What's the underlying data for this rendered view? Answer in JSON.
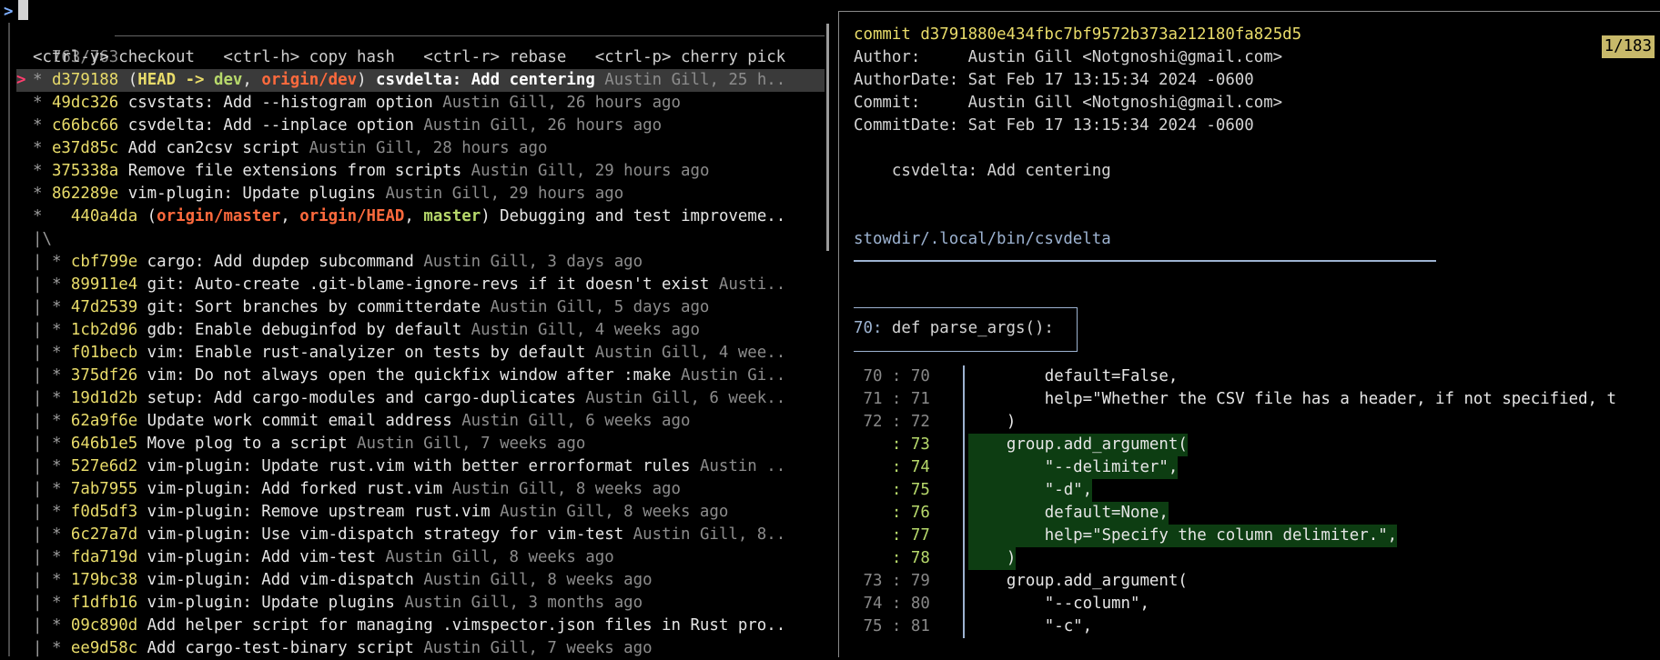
{
  "prompt": {
    "symbol": ">"
  },
  "left": {
    "counter": "763/763",
    "hints": "<ctrl-y> checkout   <ctrl-h> copy hash   <ctrl-r> rebase   <ctrl-p> cherry pick",
    "rows": [
      {
        "mark": ">",
        "graph": "* ",
        "hash": "d379188",
        "refs": [
          {
            "t": "(",
            "c": "rb"
          },
          {
            "t": "HEAD -> ",
            "c": "rh"
          },
          {
            "t": "dev",
            "c": "rg"
          },
          {
            "t": ", ",
            "c": "rb"
          },
          {
            "t": "origin/dev",
            "c": "rr"
          },
          {
            "t": ") ",
            "c": "rb"
          }
        ],
        "msg": "csvdelta: Add centering",
        "meta": " Austin Gill, 25 h..",
        "sel": true
      },
      {
        "mark": "",
        "graph": "* ",
        "hash": "49dc326",
        "refs": [],
        "msg": "csvstats: Add --histogram option",
        "meta": " Austin Gill, 26 hours ago"
      },
      {
        "mark": "",
        "graph": "* ",
        "hash": "c66bc66",
        "refs": [],
        "msg": "csvdelta: Add --inplace option",
        "meta": " Austin Gill, 26 hours ago"
      },
      {
        "mark": "",
        "graph": "* ",
        "hash": "e37d85c",
        "refs": [],
        "msg": "Add can2csv script",
        "meta": " Austin Gill, 28 hours ago"
      },
      {
        "mark": "",
        "graph": "* ",
        "hash": "375338a",
        "refs": [],
        "msg": "Remove file extensions from scripts",
        "meta": " Austin Gill, 29 hours ago"
      },
      {
        "mark": "",
        "graph": "* ",
        "hash": "862289e",
        "refs": [],
        "msg": "vim-plugin: Update plugins",
        "meta": " Austin Gill, 29 hours ago"
      },
      {
        "mark": "",
        "graph": "*   ",
        "hash": "440a4da",
        "refs": [
          {
            "t": "(",
            "c": "rb"
          },
          {
            "t": "origin/master",
            "c": "rr"
          },
          {
            "t": ", ",
            "c": "rb"
          },
          {
            "t": "origin/HEAD",
            "c": "rr"
          },
          {
            "t": ", ",
            "c": "rb"
          },
          {
            "t": "master",
            "c": "rg"
          },
          {
            "t": ") ",
            "c": "rb"
          }
        ],
        "msg": "Debugging and test improveme..",
        "meta": ""
      },
      {
        "mark": "",
        "graph": "|\\",
        "hash": "",
        "refs": [],
        "msg": "",
        "meta": ""
      },
      {
        "mark": "",
        "graph": "| * ",
        "hash": "cbf799e",
        "refs": [],
        "msg": "cargo: Add dupdep subcommand",
        "meta": " Austin Gill, 3 days ago"
      },
      {
        "mark": "",
        "graph": "| * ",
        "hash": "89911e4",
        "refs": [],
        "msg": "git: Auto-create .git-blame-ignore-revs if it doesn't exist",
        "meta": " Austi.."
      },
      {
        "mark": "",
        "graph": "| * ",
        "hash": "47d2539",
        "refs": [],
        "msg": "git: Sort branches by committerdate",
        "meta": " Austin Gill, 5 days ago"
      },
      {
        "mark": "",
        "graph": "| * ",
        "hash": "1cb2d96",
        "refs": [],
        "msg": "gdb: Enable debuginfod by default",
        "meta": " Austin Gill, 4 weeks ago"
      },
      {
        "mark": "",
        "graph": "| * ",
        "hash": "f01becb",
        "refs": [],
        "msg": "vim: Enable rust-analyizer on tests by default",
        "meta": " Austin Gill, 4 wee.."
      },
      {
        "mark": "",
        "graph": "| * ",
        "hash": "375df26",
        "refs": [],
        "msg": "vim: Do not always open the quickfix window after :make",
        "meta": " Austin Gi.."
      },
      {
        "mark": "",
        "graph": "| * ",
        "hash": "19d1d2b",
        "refs": [],
        "msg": "setup: Add cargo-modules and cargo-duplicates",
        "meta": " Austin Gill, 6 week.."
      },
      {
        "mark": "",
        "graph": "| * ",
        "hash": "62a9f6e",
        "refs": [],
        "msg": "Update work commit email address",
        "meta": " Austin Gill, 6 weeks ago"
      },
      {
        "mark": "",
        "graph": "| * ",
        "hash": "646b1e5",
        "refs": [],
        "msg": "Move plog to a script",
        "meta": " Austin Gill, 7 weeks ago"
      },
      {
        "mark": "",
        "graph": "| * ",
        "hash": "527e6d2",
        "refs": [],
        "msg": "vim-plugin: Update rust.vim with better errorformat rules",
        "meta": " Austin .."
      },
      {
        "mark": "",
        "graph": "| * ",
        "hash": "7ab7955",
        "refs": [],
        "msg": "vim-plugin: Add forked rust.vim",
        "meta": " Austin Gill, 8 weeks ago"
      },
      {
        "mark": "",
        "graph": "| * ",
        "hash": "f0d5df3",
        "refs": [],
        "msg": "vim-plugin: Remove upstream rust.vim",
        "meta": " Austin Gill, 8 weeks ago"
      },
      {
        "mark": "",
        "graph": "| * ",
        "hash": "6c27a7d",
        "refs": [],
        "msg": "vim-plugin: Use vim-dispatch strategy for vim-test",
        "meta": " Austin Gill, 8.."
      },
      {
        "mark": "",
        "graph": "| * ",
        "hash": "fda719d",
        "refs": [],
        "msg": "vim-plugin: Add vim-test",
        "meta": " Austin Gill, 8 weeks ago"
      },
      {
        "mark": "",
        "graph": "| * ",
        "hash": "179bc38",
        "refs": [],
        "msg": "vim-plugin: Add vim-dispatch",
        "meta": " Austin Gill, 8 weeks ago"
      },
      {
        "mark": "",
        "graph": "| * ",
        "hash": "f1dfb16",
        "refs": [],
        "msg": "vim-plugin: Update plugins",
        "meta": " Austin Gill, 3 months ago"
      },
      {
        "mark": "",
        "graph": "| * ",
        "hash": "09c890d",
        "refs": [],
        "msg": "Add helper script for managing .vimspector.json files in Rust pro..",
        "meta": ""
      },
      {
        "mark": "",
        "graph": "| * ",
        "hash": "ee9d58c",
        "refs": [],
        "msg": "Add cargo-test-binary script",
        "meta": " Austin Gill, 7 weeks ago"
      }
    ]
  },
  "preview": {
    "page_indicator": "1/183",
    "commit_label": "commit",
    "commit_hash": "d3791880e434fbc7bf9572b373a212180fa825d5",
    "author": "Author:     Austin Gill <Notgnoshi@gmail.com>",
    "author_date": "AuthorDate: Sat Feb 17 13:15:34 2024 -0600",
    "committer": "Commit:     Austin Gill <Notgnoshi@gmail.com>",
    "commit_date": "CommitDate: Sat Feb 17 13:15:34 2024 -0600",
    "message": "    csvdelta: Add centering",
    "file_path": "stowdir/.local/bin/csvdelta",
    "hunk_line": "70:",
    "hunk_text": " def parse_args():",
    "code": [
      {
        "old": "70",
        "new": "70",
        "text": "        default=False,",
        "added": false
      },
      {
        "old": "71",
        "new": "71",
        "text": "        help=\"Whether the CSV file has a header, if not specified, t",
        "added": false
      },
      {
        "old": "72",
        "new": "72",
        "text": "    )",
        "added": false
      },
      {
        "old": "",
        "new": "73",
        "text": "    group.add_argument(",
        "added": true
      },
      {
        "old": "",
        "new": "74",
        "text": "        \"--delimiter\",",
        "added": true
      },
      {
        "old": "",
        "new": "75",
        "text": "        \"-d\",",
        "added": true
      },
      {
        "old": "",
        "new": "76",
        "text": "        default=None,",
        "added": true
      },
      {
        "old": "",
        "new": "77",
        "text": "        help=\"Specify the column delimiter.\",",
        "added": true
      },
      {
        "old": "",
        "new": "78",
        "text": "    )",
        "added": true
      },
      {
        "old": "73",
        "new": "79",
        "text": "    group.add_argument(",
        "added": false
      },
      {
        "old": "74",
        "new": "80",
        "text": "        \"--column\",",
        "added": false
      },
      {
        "old": "75",
        "new": "81",
        "text": "        \"-c\",",
        "added": false
      }
    ]
  }
}
